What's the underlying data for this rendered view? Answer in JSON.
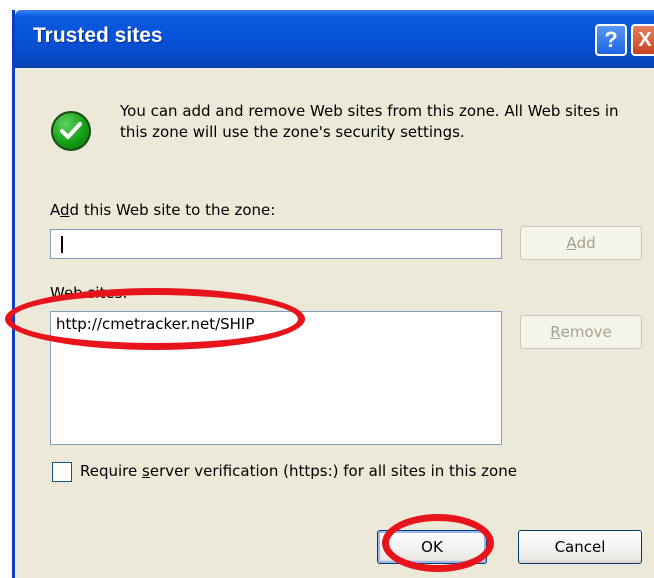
{
  "window": {
    "title": "Trusted sites",
    "help_button_label": "?",
    "close_button_label": "X"
  },
  "info": {
    "icon": "checkmark-shield-icon",
    "text": "You can add and remove Web sites from this zone. All Web sites in this zone will use the zone's security settings."
  },
  "add_field": {
    "label_pre": "A",
    "label_key": "d",
    "label_post": "d this Web site to the zone:",
    "value": ""
  },
  "add_button": {
    "label_key": "A",
    "label_post": "dd",
    "enabled": false
  },
  "sites_list": {
    "label_key": "W",
    "label_post": "eb sites:",
    "items": [
      "http://cmetracker.net/SHIP"
    ]
  },
  "remove_button": {
    "label_key": "R",
    "label_post": "emove",
    "enabled": false
  },
  "require_https": {
    "label_pre": "Require ",
    "label_key": "s",
    "label_post": "erver verification (https:) for all sites in this zone",
    "checked": false
  },
  "buttons": {
    "ok": "OK",
    "cancel": "Cancel"
  },
  "colors": {
    "titlebar": "#0852d8",
    "dialog_bg": "#ece9d8",
    "highlight_circle": "#e8141c"
  }
}
